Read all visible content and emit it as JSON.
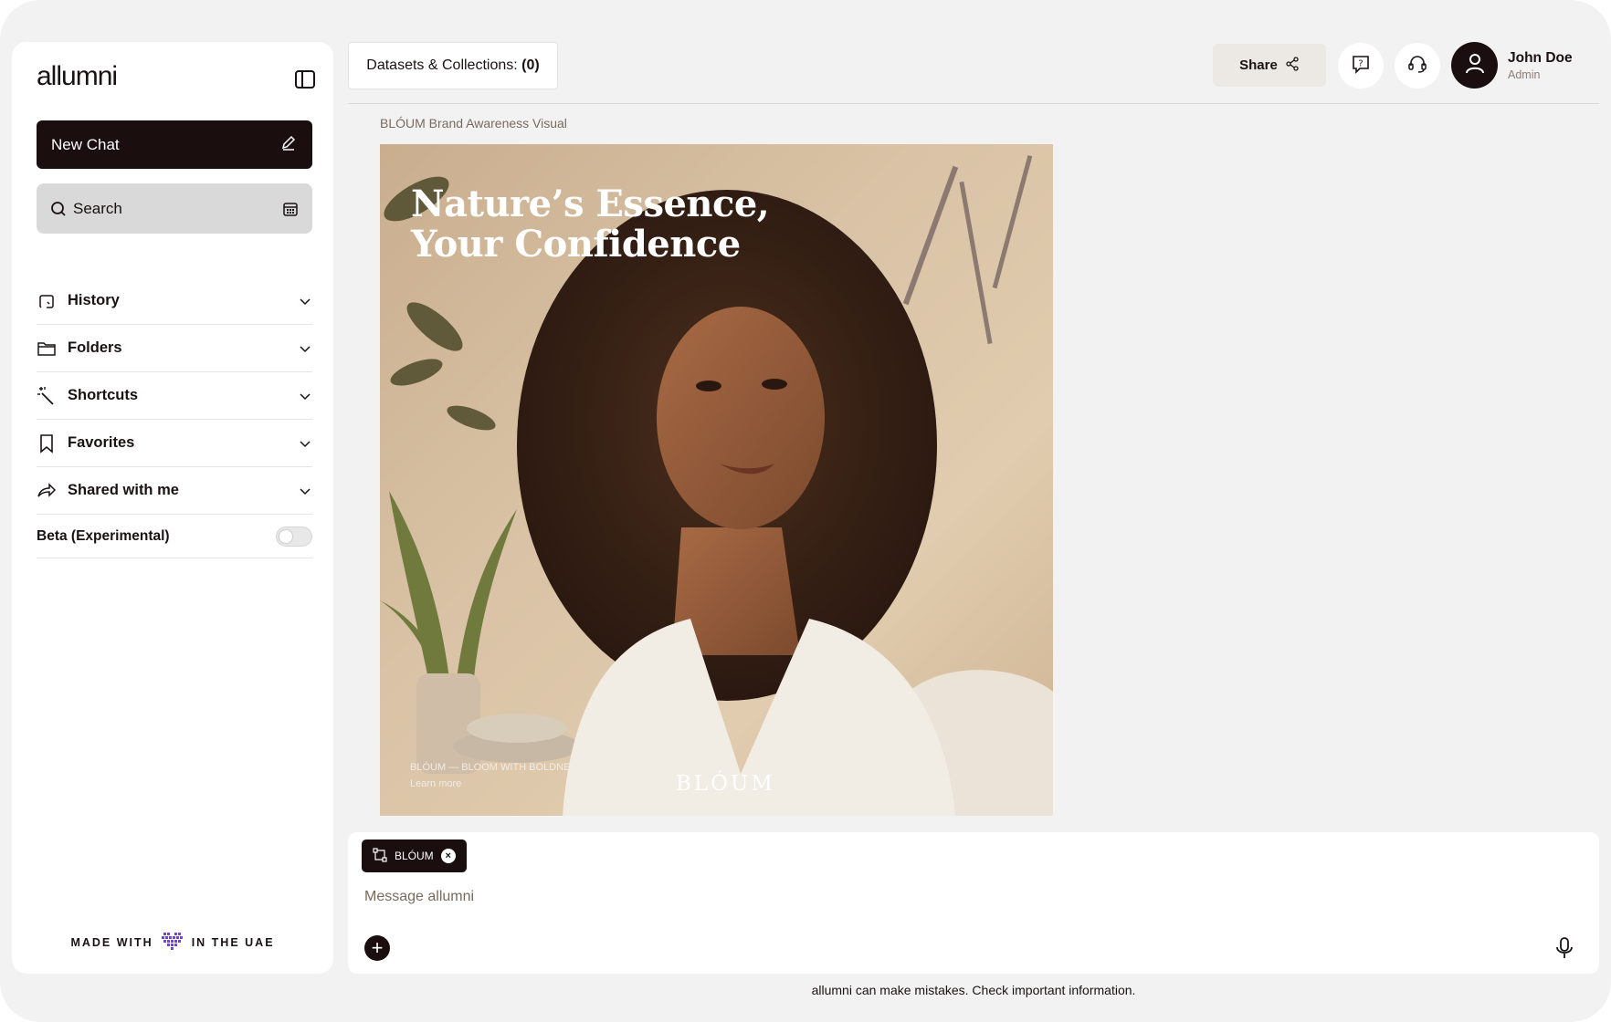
{
  "app": {
    "logo": "allumni"
  },
  "sidebar": {
    "new_chat": "New Chat",
    "search_label": "Search",
    "items": [
      {
        "label": "History",
        "icon": "history-icon"
      },
      {
        "label": "Folders",
        "icon": "folder-icon"
      },
      {
        "label": "Shortcuts",
        "icon": "magic-wand-icon"
      },
      {
        "label": "Favorites",
        "icon": "bookmark-icon"
      },
      {
        "label": "Shared with me",
        "icon": "share-arrow-icon"
      }
    ],
    "beta_label": "Beta (Experimental)",
    "beta_enabled": false,
    "footer_left": "MADE WITH",
    "footer_right": "IN THE UAE"
  },
  "header": {
    "datasets_label": "Datasets & Collections:",
    "datasets_count": "(0)",
    "share_label": "Share",
    "user_name": "John Doe",
    "user_role": "Admin"
  },
  "content": {
    "caption": "BLÓUM Brand Awareness Visual",
    "headline_line1": "Nature’s Essence,",
    "headline_line2": "Your Confidence",
    "tagline": "BLÓUM — BLOOM WITH BOLDNESS",
    "learn_more": "Learn more",
    "wordmark": "BLÓUM"
  },
  "composer": {
    "chip_label": "BLÓUM",
    "placeholder": "Message allumni"
  },
  "disclaimer": "allumni can make mistakes. Check important information.",
  "colors": {
    "accent_dark": "#1a0e0e",
    "background": "#f2f2f2",
    "share_bg": "#ece8e3",
    "heart": "#7a3cf0"
  }
}
